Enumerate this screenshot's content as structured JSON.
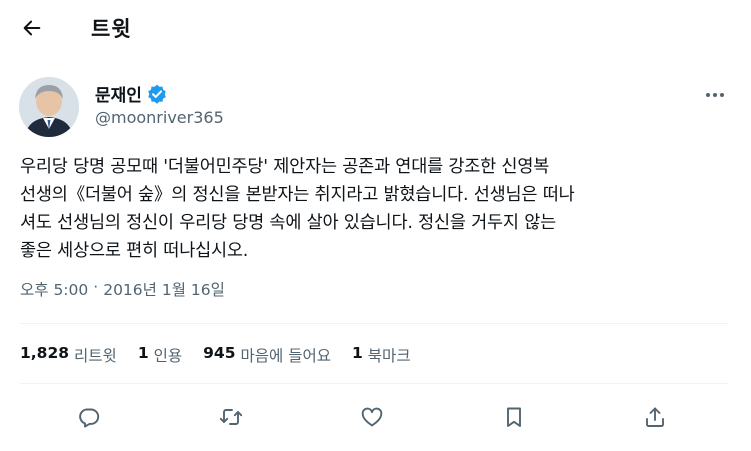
{
  "header": {
    "title": "트윗"
  },
  "author": {
    "name": "문재인",
    "handle": "@moonriver365",
    "verified": true,
    "avatar_icon": "profile-photo",
    "verified_color": "#1d9bf0"
  },
  "tweet": {
    "text": "우리당 당명 공모때 '더불어민주당' 제안자는 공존과 연대를 강조한 신영복\n선생의《더불어 숲》의 정신을 본받자는 취지라고 밝혔습니다. 선생님은 떠나\n셔도 선생님의 정신이 우리당 당명 속에 살아 있습니다. 정신을 거두지 않는\n좋은 세상으로 편히 떠나십시오.",
    "time": "오후 5:00",
    "separator": "·",
    "date": "2016년 1월 16일"
  },
  "stats": [
    {
      "count": "1,828",
      "label": "리트윗"
    },
    {
      "count": "1",
      "label": "인용"
    },
    {
      "count": "945",
      "label": "마음에 들어요"
    },
    {
      "count": "1",
      "label": "북마크"
    }
  ],
  "actions": [
    "reply-icon",
    "retweet-icon",
    "like-icon",
    "bookmark-icon",
    "share-icon"
  ],
  "colors": {
    "text": "#0f1419",
    "secondary": "#536471",
    "divider": "#eff3f4",
    "accent": "#1d9bf0"
  }
}
